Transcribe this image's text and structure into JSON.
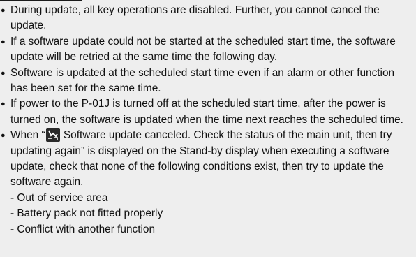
{
  "notes": [
    {
      "text": "During update, all key operations are disabled. Further, you cannot cancel the update."
    },
    {
      "text": "If a software update could not be started at the scheduled start time, the software update will be retried at the same time the following day."
    },
    {
      "text": "Software is updated at the scheduled start time even if an alarm or other function has been set for the same time."
    },
    {
      "text": "If power to the P-01J is turned off at the scheduled start time, after the power is turned on, the software is updated when the time next reaches the scheduled time."
    },
    {
      "prefix": "When “",
      "icon": "software-update-icon",
      "text": " Software update canceled. Check the status of the main unit, then try updating again” is displayed on the Stand-by display when executing a software update, check that none of the following conditions exist, then try to update the software again."
    }
  ],
  "conditions": [
    "- Out of service area",
    "- Battery pack not fitted properly",
    "- Conflict with another function"
  ],
  "bullet_glyph": "●"
}
